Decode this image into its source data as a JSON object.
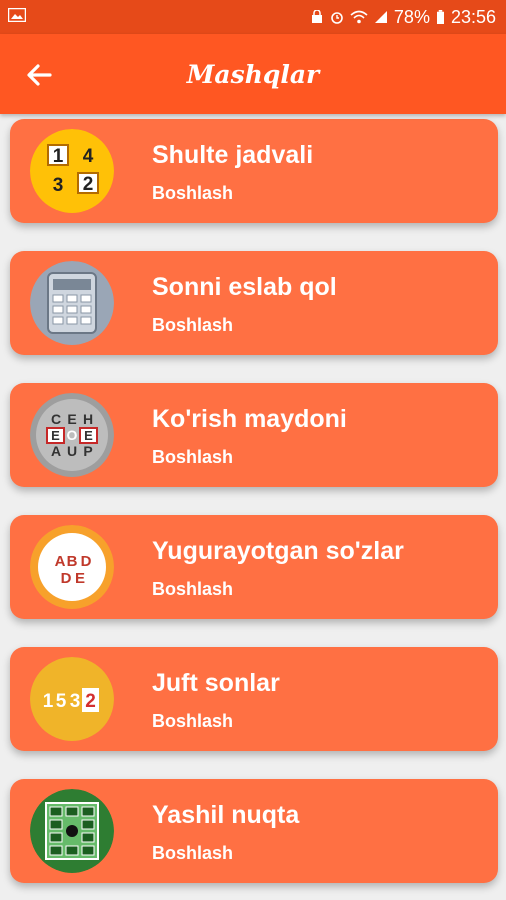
{
  "status": {
    "battery": "78%",
    "time": "23:56"
  },
  "header": {
    "title": "Mashqlar"
  },
  "items": [
    {
      "name": "Shulte jadvali",
      "action": "Boshlash",
      "icon": "schulte-table-icon"
    },
    {
      "name": "Sonni eslab qol",
      "action": "Boshlash",
      "icon": "calculator-icon"
    },
    {
      "name": "Ko'rish maydoni",
      "action": "Boshlash",
      "icon": "letter-grid-icon"
    },
    {
      "name": "Yugurayotgan so'zlar",
      "action": "Boshlash",
      "icon": "abde-icon"
    },
    {
      "name": "Juft sonlar",
      "action": "Boshlash",
      "icon": "numbers-1532-icon"
    },
    {
      "name": "Yashil nuqta",
      "action": "Boshlash",
      "icon": "green-dot-grid-icon"
    }
  ],
  "colors": {
    "statusbar": "#e64a19",
    "appbar": "#ff5722",
    "card": "#ff7043",
    "background": "#efefef"
  }
}
